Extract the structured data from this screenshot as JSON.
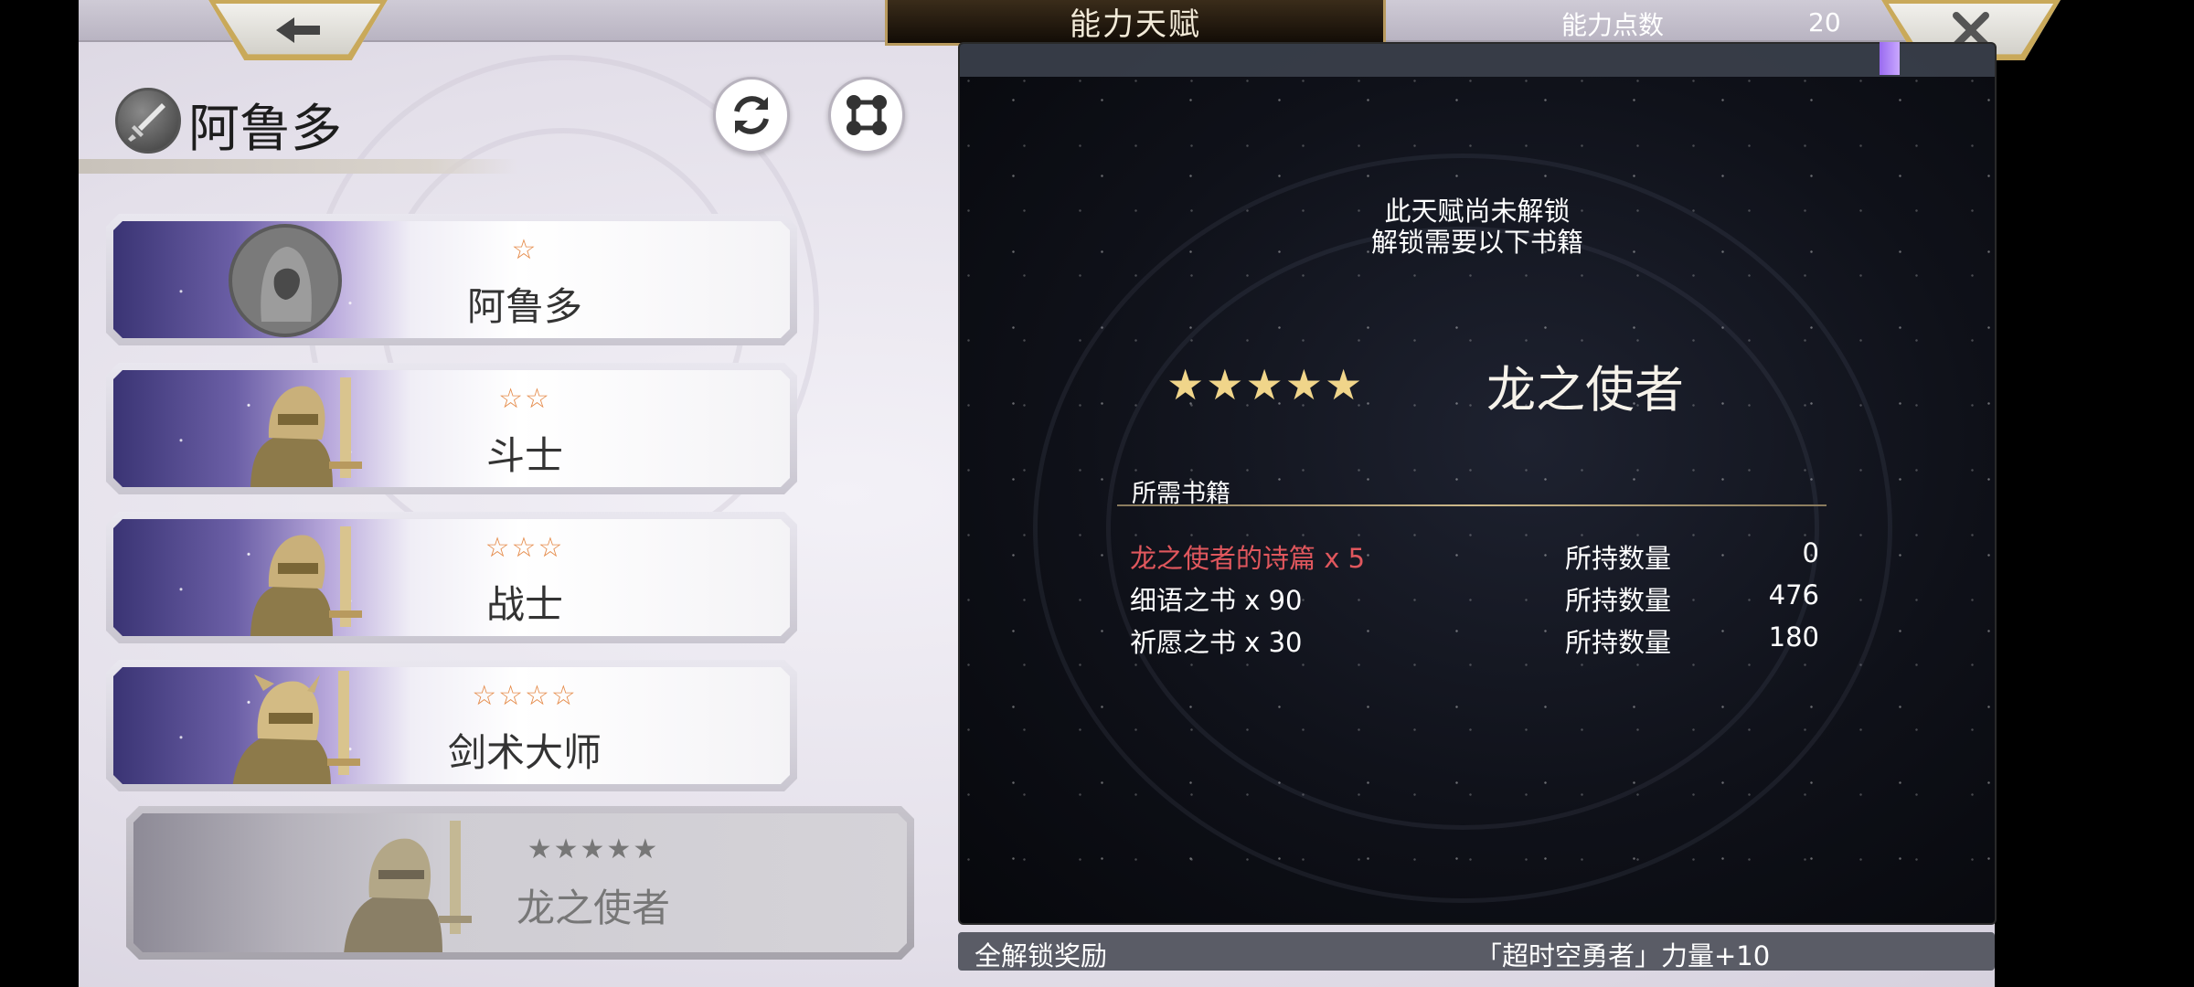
{
  "header": {
    "title": "能力天赋",
    "points_label": "能力点数",
    "points_value": "20",
    "back_icon": "back-arrow-icon",
    "close_icon": "close-x-icon"
  },
  "character": {
    "name": "阿鲁多",
    "icon": "sword-icon",
    "refresh_icon": "refresh-icon",
    "network_icon": "node-network-icon"
  },
  "classes": [
    {
      "stars": "☆",
      "name": "阿鲁多",
      "locked": false
    },
    {
      "stars": "☆☆",
      "name": "斗士",
      "locked": false
    },
    {
      "stars": "☆☆☆",
      "name": "战士",
      "locked": false
    },
    {
      "stars": "☆☆☆☆",
      "name": "剑术大师",
      "locked": false
    },
    {
      "stars": "★★★★★",
      "name": "龙之使者",
      "locked": true
    }
  ],
  "detail": {
    "unlock_line1": "此天赋尚未解锁",
    "unlock_line2": "解锁需要以下书籍",
    "stars": "★★★★★",
    "name": "龙之使者",
    "books_header": "所需书籍",
    "books": [
      {
        "name": "龙之使者的诗篇 x 5",
        "label": "所持数量",
        "count": "0",
        "missing": true
      },
      {
        "name": "细语之书 x 90",
        "label": "所持数量",
        "count": "476",
        "missing": false
      },
      {
        "name": "祈愿之书 x 30",
        "label": "所持数量",
        "count": "180",
        "missing": false
      }
    ]
  },
  "reward": {
    "label": "全解锁奖励",
    "value": "「超时空勇者」力量+10"
  },
  "colors": {
    "accent_gold": "#c9a95a",
    "missing_red": "#e0575d",
    "star_orange": "#e58a48",
    "purple_mark": "#9a6bf0"
  }
}
